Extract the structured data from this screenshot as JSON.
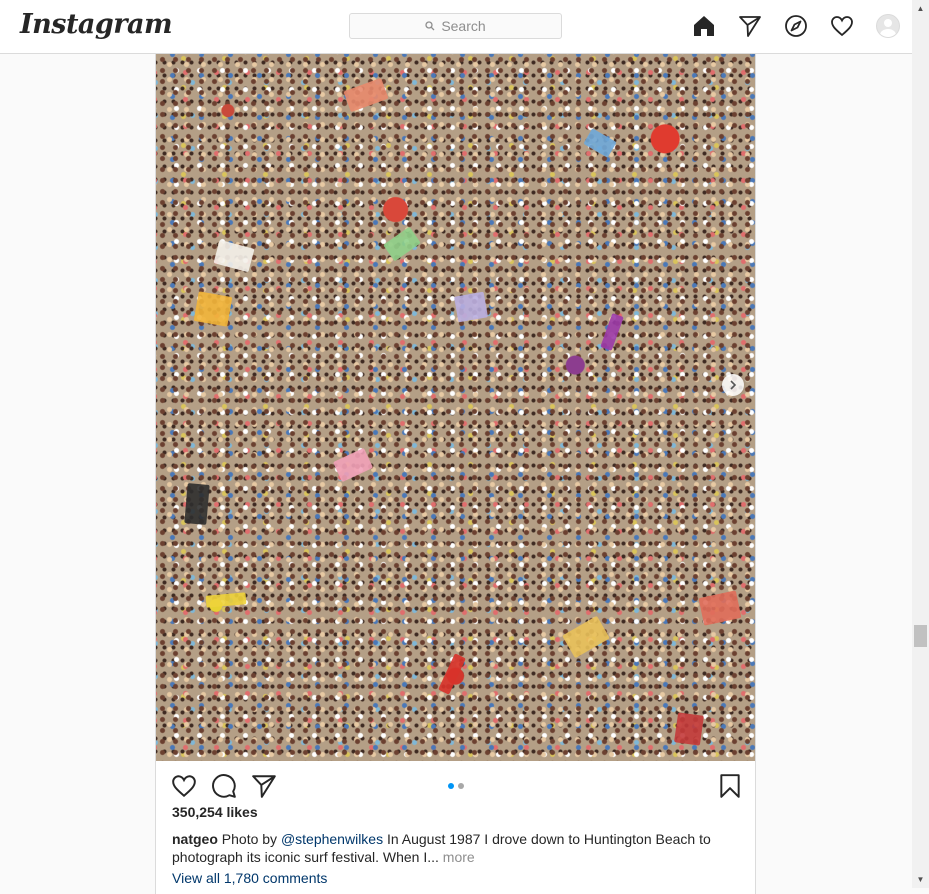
{
  "nav": {
    "logo": "Instagram",
    "search_placeholder": "Search",
    "icons": [
      "home-icon",
      "direct-icon",
      "explore-icon",
      "activity-icon",
      "profile-icon"
    ]
  },
  "post": {
    "photo_alt": "Aerial photo of a crowded beach",
    "carousel": {
      "current": 1,
      "total": 2
    },
    "likes": "350,254 likes",
    "caption": {
      "username": "natgeo",
      "text_before": " Photo by ",
      "mention": "@stephenwilkes",
      "text_after": " In August 1987 I drove down to Huntington Beach to photograph its iconic surf festival. When I...",
      "more": " more"
    },
    "view_comments": "View all 1,780 comments"
  },
  "colors": {
    "accent": "#0095f6",
    "border": "#dbdbdb",
    "link": "#00376b"
  }
}
